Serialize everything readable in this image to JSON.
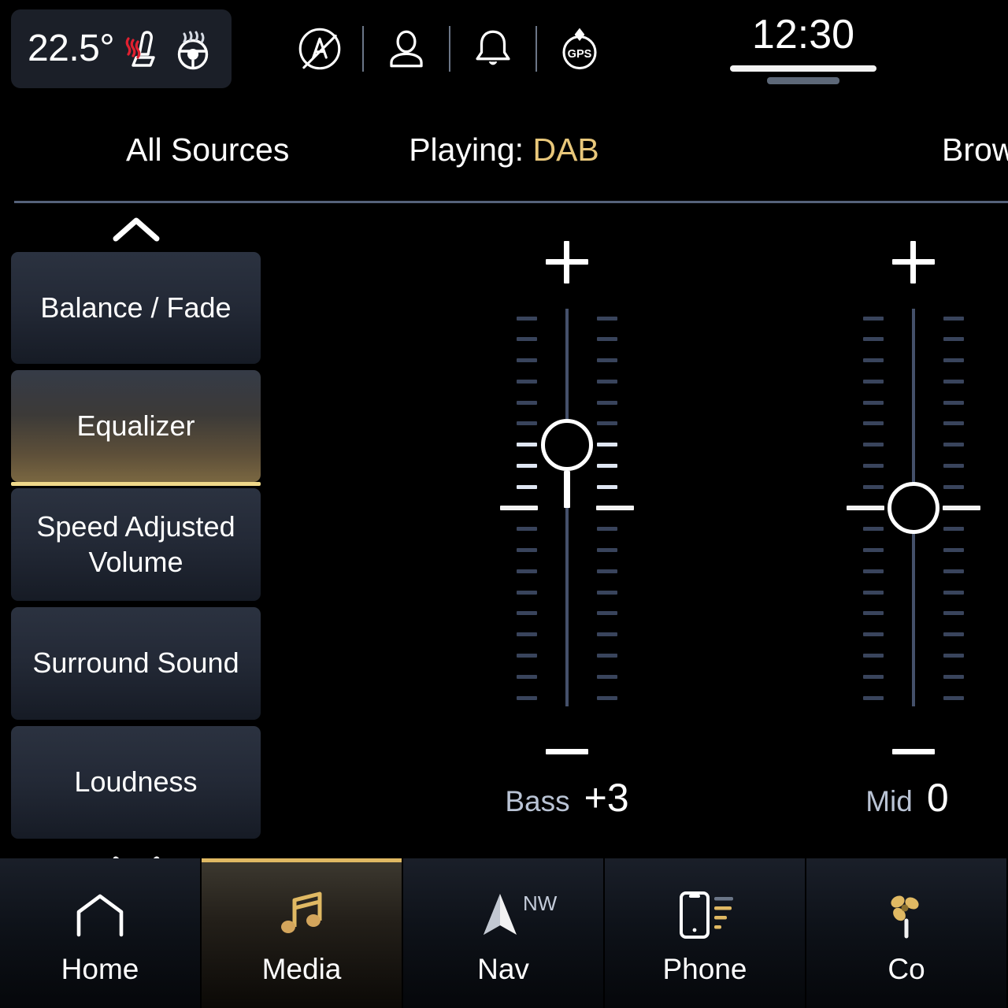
{
  "status_bar": {
    "temperature": "22.5°",
    "seat_heat_icon": "heated-seat-icon",
    "steering_heat_icon": "heated-steering-wheel-icon",
    "icons": [
      {
        "name": "auto-start-stop-icon",
        "label": "A"
      },
      {
        "name": "user-profile-icon",
        "label": ""
      },
      {
        "name": "notification-bell-icon",
        "label": ""
      },
      {
        "name": "gps-icon",
        "label": "GPS"
      }
    ],
    "clock": "12:30"
  },
  "top_nav": {
    "all_sources": "All Sources",
    "playing_prefix": "Playing: ",
    "playing_source": "DAB",
    "browse": "Brow"
  },
  "sidebar": {
    "scroll_up": "chevron-up-icon",
    "scroll_down": "chevron-down-icon",
    "items": [
      {
        "label": "Balance / Fade",
        "active": false
      },
      {
        "label": "Equalizer",
        "active": true
      },
      {
        "label": "Speed Adjusted Volume",
        "active": false
      },
      {
        "label": "Surround Sound",
        "active": false
      },
      {
        "label": "Loudness",
        "active": false
      }
    ]
  },
  "equalizer": {
    "increase_label": "+",
    "decrease_label": "−",
    "range": {
      "min": -9,
      "max": 9
    },
    "bands": [
      {
        "name": "Bass",
        "value": 3,
        "display": "+3"
      },
      {
        "name": "Mid",
        "value": 0,
        "display": "0"
      }
    ]
  },
  "tab_bar": {
    "tabs": [
      {
        "label": "Home",
        "icon": "home-icon",
        "active": false,
        "badge": ""
      },
      {
        "label": "Media",
        "icon": "music-note-icon",
        "active": true,
        "badge": ""
      },
      {
        "label": "Nav",
        "icon": "navigation-arrow-icon",
        "active": false,
        "badge": "NW"
      },
      {
        "label": "Phone",
        "icon": "phone-icon",
        "active": false,
        "badge": ""
      },
      {
        "label": "Co",
        "icon": "climate-fan-icon",
        "active": false,
        "badge": ""
      }
    ]
  },
  "colors": {
    "accent_gold": "#e0b963",
    "accent_gold_light": "#f0d98a",
    "background": "#000000",
    "panel": "#232936",
    "text_primary": "#ffffff",
    "text_secondary": "#b9c3d4",
    "track": "#44506a"
  }
}
